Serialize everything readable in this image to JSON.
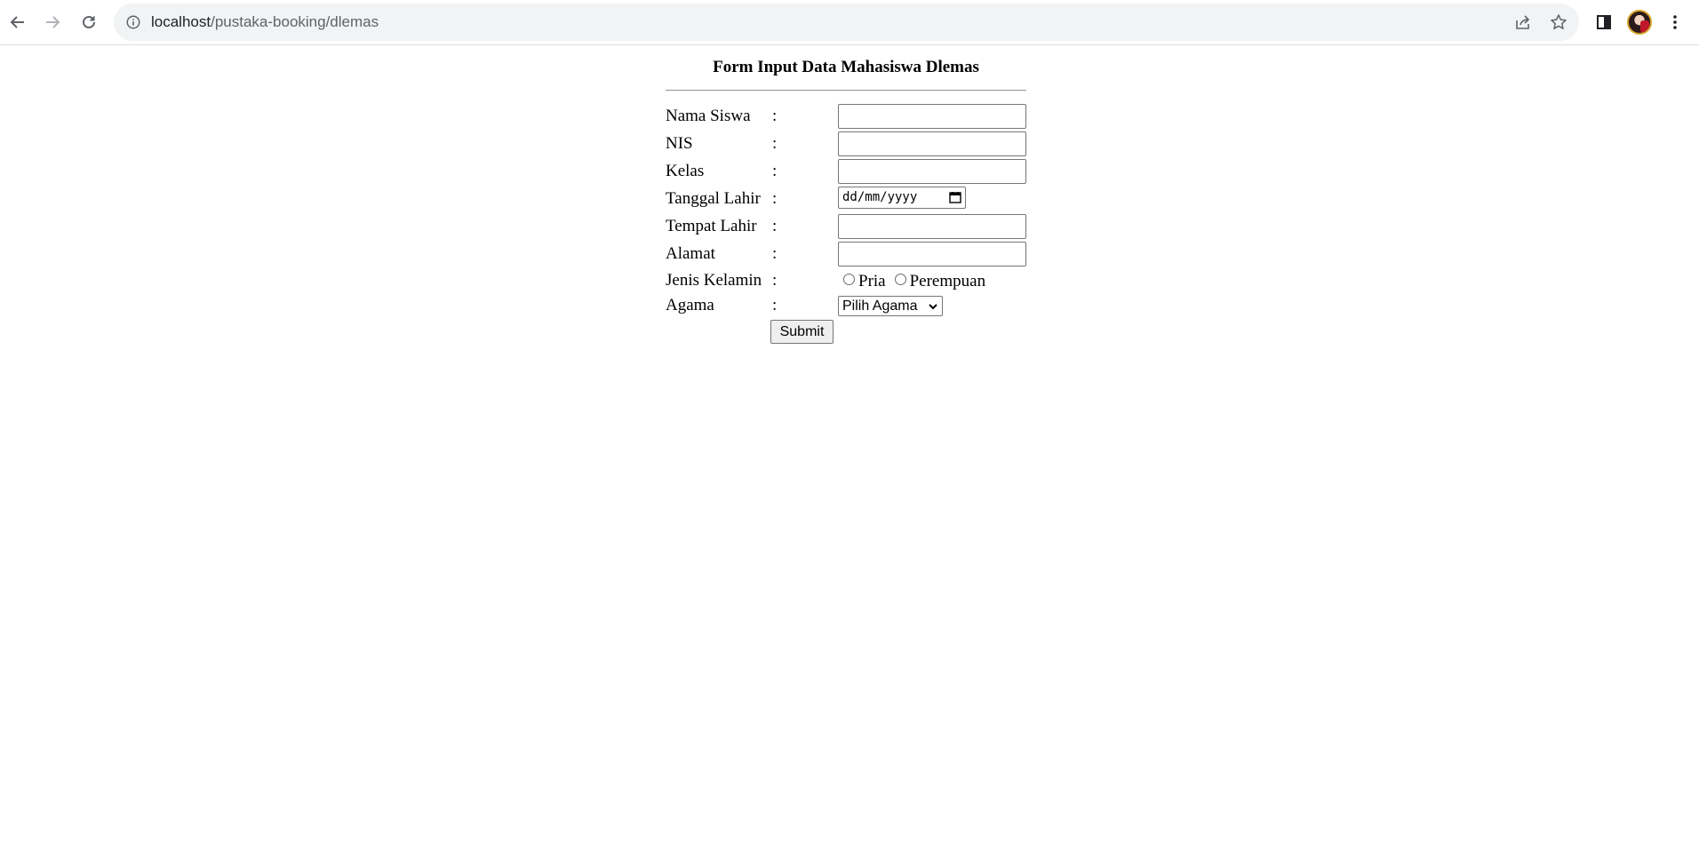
{
  "browser": {
    "url_host": "localhost",
    "url_path": "/pustaka-booking/dlemas"
  },
  "form": {
    "title": "Form Input Data Mahasiswa Dlemas",
    "colon": ":",
    "fields": {
      "nama_siswa": {
        "label": "Nama Siswa",
        "value": ""
      },
      "nis": {
        "label": "NIS",
        "value": ""
      },
      "kelas": {
        "label": "Kelas",
        "value": ""
      },
      "tanggal_lahir": {
        "label": "Tanggal Lahir",
        "placeholder": "dd/mm/yyyy"
      },
      "tempat_lahir": {
        "label": "Tempat Lahir",
        "value": ""
      },
      "alamat": {
        "label": "Alamat",
        "value": ""
      },
      "jenis_kelamin": {
        "label": "Jenis Kelamin",
        "options": [
          "Pria",
          "Perempuan"
        ]
      },
      "agama": {
        "label": "Agama",
        "selected": "Pilih Agama"
      }
    },
    "submit_label": "Submit"
  }
}
